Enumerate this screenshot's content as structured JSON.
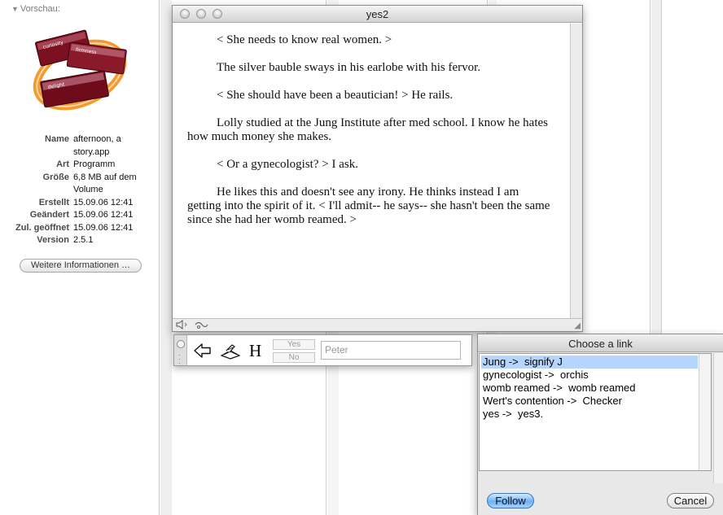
{
  "preview": {
    "header": "Vorschau:",
    "icon_words": [
      "curiosity",
      "firmness",
      "delight"
    ],
    "info": [
      {
        "key": "Name",
        "value": "afternoon, a story.app"
      },
      {
        "key": "Art",
        "value": "Programm"
      },
      {
        "key": "Größe",
        "value": "6,8 MB auf dem Volume"
      },
      {
        "key": "Erstellt",
        "value": "15.09.06 12:41"
      },
      {
        "key": "Geändert",
        "value": "15.09.06 12:41"
      },
      {
        "key": "Zul. geöffnet",
        "value": "15.09.06 12:41"
      },
      {
        "key": "Version",
        "value": "2.5.1"
      }
    ],
    "more_info_button": "Weitere Informationen …"
  },
  "story_window": {
    "title": "yes2",
    "paragraphs": [
      "< She needs to know real women. >",
      "The silver bauble sways in his earlobe with his fervor.",
      "< She should have been a beautician! >  He rails.",
      "Lolly studied at the Jung Institute after med school.  I know he hates how much money she makes.",
      "< Or a gynecologist? > I ask.",
      "He likes this and doesn't see any irony.  He thinks instead I am getting into the spirit of it.  < I'll admit-- he says-- she hasn't been the same since she had her womb  reamed. >"
    ]
  },
  "toolbar": {
    "history_label": "H",
    "yes_label": "Yes",
    "no_label": "No",
    "name_value": "Peter"
  },
  "link_dialog": {
    "title": "Choose a link",
    "links": [
      "Jung ->  signify J",
      "gynecologist ->  orchis",
      "womb reamed ->  womb reamed",
      "Wert's contention ->  Checker",
      "yes ->  yes3."
    ],
    "selected_index": 0,
    "follow_button": "Follow",
    "cancel_button": "Cancel"
  },
  "colors": {
    "selection": "#b5d5ff",
    "default_button": "#6fb0f4",
    "icon_ring": "#f39a2c",
    "icon_card": "#7a1020"
  },
  "icons": {
    "back": "left-arrow-icon",
    "reader": "reading-hand-icon",
    "speaker": "speaker-icon",
    "voice": "speech-icon"
  }
}
